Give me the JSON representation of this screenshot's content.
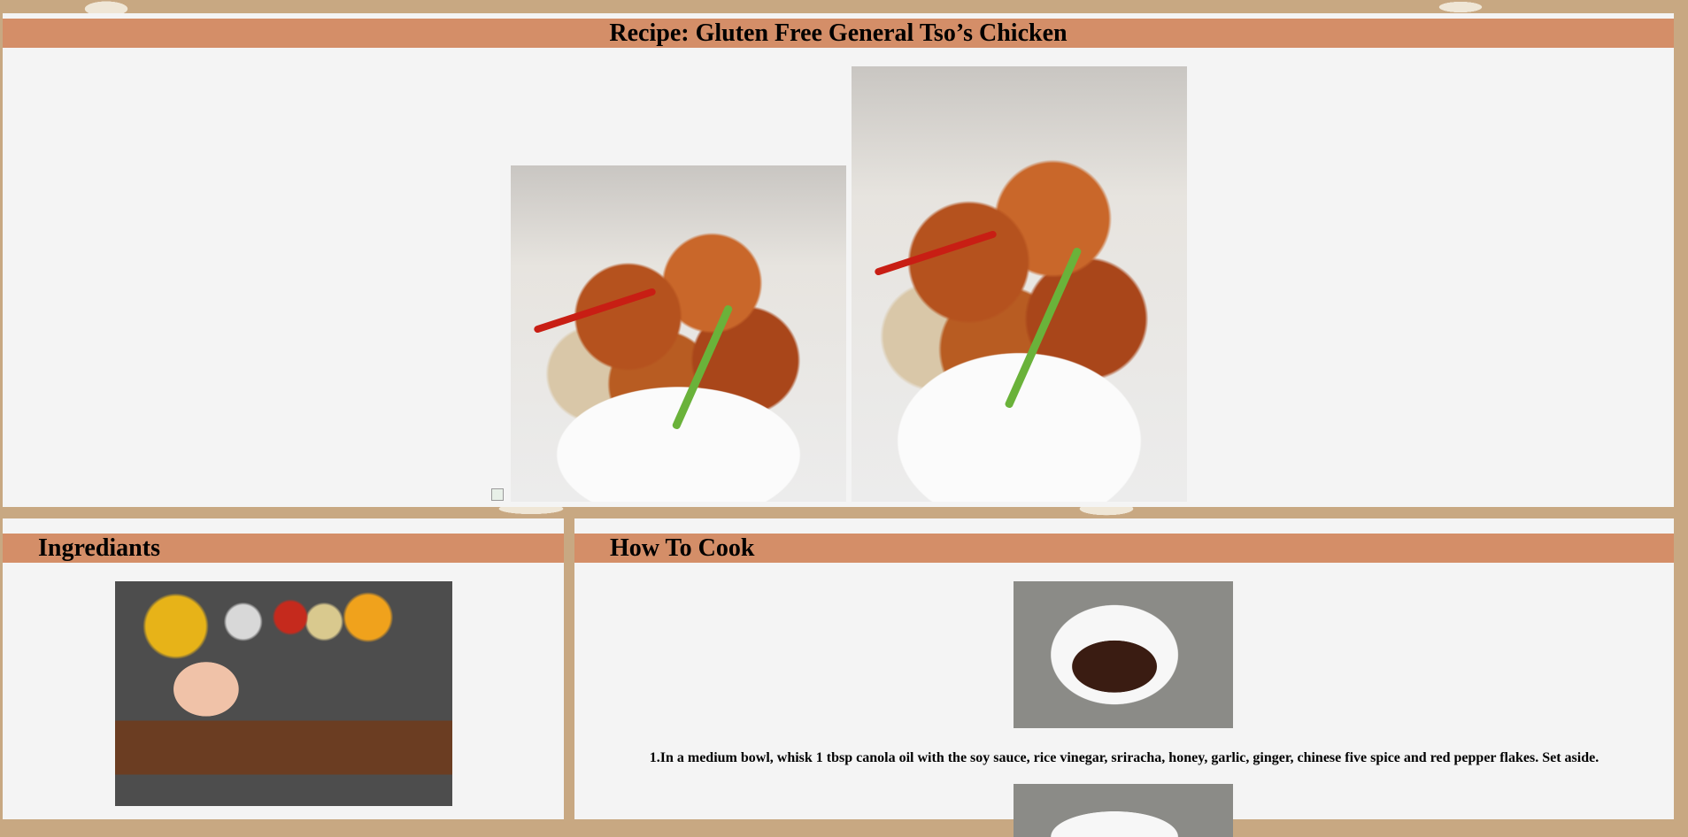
{
  "recipe": {
    "title": "Recipe: Gluten Free General Tso’s Chicken"
  },
  "ingredients": {
    "heading": "Ingrediants"
  },
  "cook": {
    "heading": "How To Cook",
    "steps": [
      "1.In a medium bowl, whisk 1 tbsp canola oil with the soy sauce, rice vinegar, sriracha, honey, garlic, ginger, chinese five spice and red pepper flakes. Set aside."
    ]
  }
}
